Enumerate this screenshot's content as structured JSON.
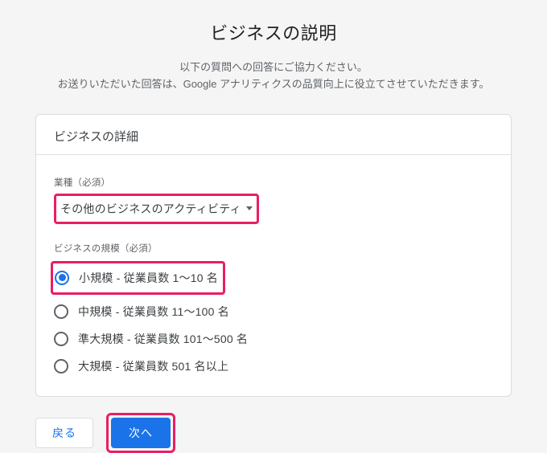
{
  "header": {
    "title": "ビジネスの説明",
    "desc_line1": "以下の質問への回答にご協力ください。",
    "desc_line2": "お送りいただいた回答は、Google アナリティクスの品質向上に役立てさせていただきます。"
  },
  "card": {
    "title": "ビジネスの詳細"
  },
  "industry": {
    "label": "業種（必須）",
    "selected": "その他のビジネスのアクティビティ"
  },
  "size": {
    "label": "ビジネスの規模（必須）",
    "options": [
      {
        "label": "小規模 - 従業員数 1〜10 名",
        "selected": true
      },
      {
        "label": "中規模 - 従業員数 11〜100 名",
        "selected": false
      },
      {
        "label": "準大規模 - 従業員数 101〜500 名",
        "selected": false
      },
      {
        "label": "大規模 - 従業員数 501 名以上",
        "selected": false
      }
    ]
  },
  "footer": {
    "back": "戻る",
    "next": "次へ"
  },
  "highlight_color": "#e91e63",
  "accent_color": "#1a73e8"
}
